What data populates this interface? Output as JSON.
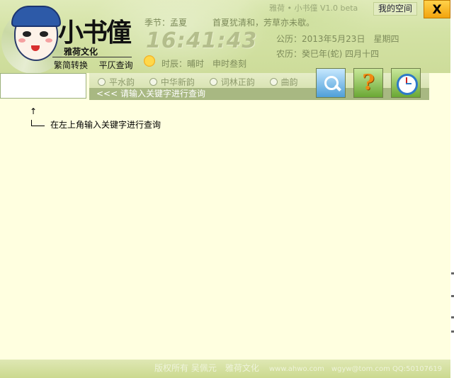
{
  "window": {
    "title": "雅荷 • 小书僮 V1.0 beta",
    "my_space_label": "我的空间",
    "close_label": "X"
  },
  "logo": {
    "title": "小书僮",
    "subtitle": "雅荷文化",
    "actions": [
      "繁简转换",
      "平仄查询"
    ]
  },
  "info": {
    "season": "季节：孟夏",
    "poem": "首夏犹清和，芳草亦未歇。",
    "time": "16:41:43",
    "gregorian": "公历：2013年5月23日　星期四",
    "lunar": "农历：癸巳年(蛇) 四月十四",
    "shichen": "时辰：晡时　申时叁刻"
  },
  "search": {
    "value": "",
    "options": [
      "平水韵",
      "中华新韵",
      "词林正韵",
      "曲韵"
    ],
    "hint": "<<< 请输入关键字进行查询"
  },
  "tools": [
    {
      "name": "search-tool",
      "icon": "search-icon"
    },
    {
      "name": "help-tool",
      "icon": "question-icon"
    },
    {
      "name": "clock-tool",
      "icon": "clock-icon"
    }
  ],
  "content": {
    "arrow": "↑",
    "instruction": "在左上角输入关键字进行查询"
  },
  "footer": {
    "copyright": "版权所有 吴佩元　雅荷文化",
    "links": "www.ahwo.com　wgyw@tom.com QQ:50107619"
  },
  "colors": {
    "background": "#ffffe0",
    "header": "#d3e2a4",
    "close_button": "#f2a40e"
  }
}
